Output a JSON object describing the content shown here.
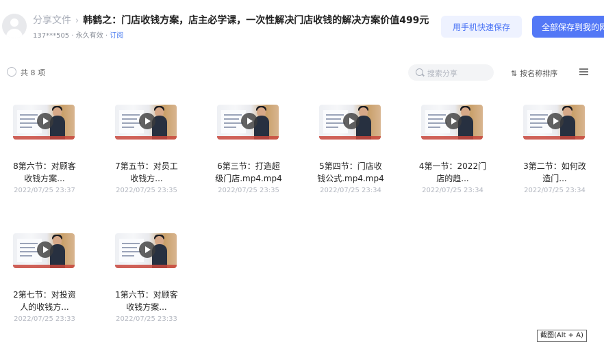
{
  "header": {
    "breadcrumb": "分享文件",
    "separator": "›",
    "title": "韩鹤之：门店收钱方案，店主必学课，一次性解决门店收钱的解决方案价值499元",
    "user": "137***505",
    "validity": "· 永久有效 ·",
    "subscribe_label": "订阅",
    "phone_save_label": "用手机快速保存",
    "save_all_label": "全部保存到我的网盘"
  },
  "toolbar": {
    "count_label": "共 8 项",
    "search_placeholder": "搜索分享",
    "sort_label": "按名称排序",
    "sort_icon": "⇅"
  },
  "files": [
    {
      "name": "8第六节：对顾客\n收钱方案...",
      "date": "2022/07/25 23:37"
    },
    {
      "name": "7第五节：对员工\n收钱方...",
      "date": "2022/07/25 23:35"
    },
    {
      "name": "6第三节：打造超\n级门店.mp4.mp4",
      "date": "2022/07/25 23:35"
    },
    {
      "name": "5第四节：门店收\n钱公式.mp4.mp4",
      "date": "2022/07/25 23:34"
    },
    {
      "name": "4第一节：2022门\n店的趋...",
      "date": "2022/07/25 23:34"
    },
    {
      "name": "3第二节：如何改\n造门...",
      "date": "2022/07/25 23:34"
    },
    {
      "name": "2第七节：对投资\n人的收钱方...",
      "date": "2022/07/25 23:33"
    },
    {
      "name": "1第六节：对顾客\n收钱方案...",
      "date": "2022/07/25 23:33"
    }
  ],
  "screenshot_tip": "截图(Alt + A)"
}
